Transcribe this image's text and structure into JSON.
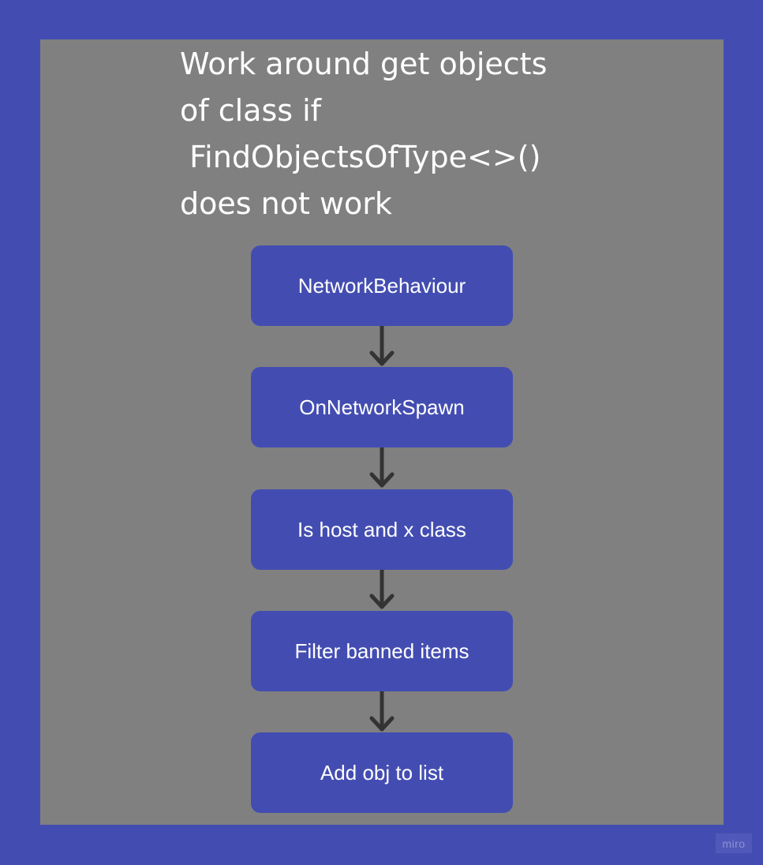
{
  "title": {
    "lines": [
      "Work around get objects",
      "of class if",
      " FindObjectsOfType<>()",
      "does not work"
    ]
  },
  "nodes": [
    {
      "label": "NetworkBehaviour"
    },
    {
      "label": "OnNetworkSpawn"
    },
    {
      "label": "Is host and x class"
    },
    {
      "label": "Filter banned items"
    },
    {
      "label": "Add obj to list"
    }
  ],
  "watermark": "miro",
  "colors": {
    "background": "#434db1",
    "frame": "#808080",
    "node": "#434db1",
    "arrow": "#333333",
    "text": "#ffffff"
  }
}
